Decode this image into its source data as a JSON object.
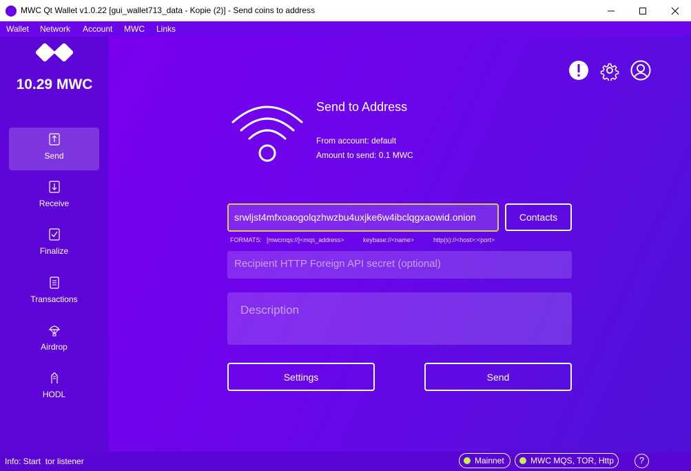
{
  "window": {
    "title": "MWC Qt Wallet v1.0.22 [gui_wallet713_data - Kopie (2)] - Send coins to address",
    "minimize_icon": "minimize-icon",
    "maximize_icon": "maximize-icon",
    "close_icon": "close-icon"
  },
  "menu": [
    "Wallet",
    "Network",
    "Account",
    "MWC",
    "Links"
  ],
  "sidebar": {
    "balance": "10.29 MWC",
    "items": [
      {
        "label": "Send",
        "icon": "send-icon",
        "active": true
      },
      {
        "label": "Receive",
        "icon": "receive-icon",
        "active": false
      },
      {
        "label": "Finalize",
        "icon": "finalize-icon",
        "active": false
      },
      {
        "label": "Transactions",
        "icon": "transactions-icon",
        "active": false
      },
      {
        "label": "Airdrop",
        "icon": "airdrop-icon",
        "active": false
      },
      {
        "label": "HODL",
        "icon": "hodl-icon",
        "active": false
      }
    ]
  },
  "main": {
    "title": "Send to Address",
    "from_account": "From account: default",
    "amount": "Amount to send: 0.1 MWC",
    "address_value": "srwljst4mfxoaogolqzhwzbu4uxjke6w4ibclqgxaowid.onion",
    "contacts_label": "Contacts",
    "formats": {
      "label": "FORMATS:",
      "mqs": "[mwcmqs://]<mqs_address>",
      "keybase": "keybase://<name>",
      "http": "http(s)://<host>:<port>"
    },
    "secret_placeholder": "Recipient HTTP Foreign API secret (optional)",
    "description_placeholder": "Description",
    "settings_label": "Settings",
    "send_label": "Send",
    "header_icons": [
      "notification-icon",
      "settings-gear-icon",
      "account-icon"
    ]
  },
  "statusbar": {
    "info": "Info: Start  tor listener",
    "network": "Mainnet",
    "listeners": "MWC MQS, TOR, Http",
    "help": "?"
  },
  "colors": {
    "accent_purple": "#6a06ea",
    "sidebar": "#5e06d8",
    "status_dot": "#c6f04a",
    "input_border": "#d3d15a"
  }
}
